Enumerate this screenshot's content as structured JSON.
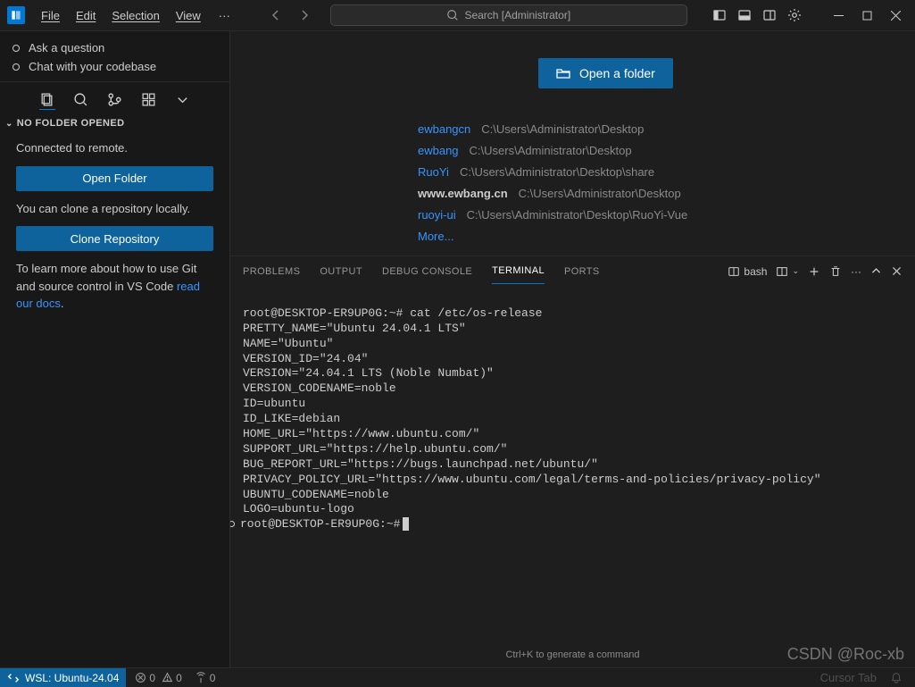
{
  "menu": {
    "file": "File",
    "edit": "Edit",
    "selection": "Selection",
    "view": "View",
    "ellipsis": "···"
  },
  "search": {
    "placeholder": "Search [Administrator]"
  },
  "chat": {
    "ask": "Ask a question",
    "codebase": "Chat with your codebase"
  },
  "explorer": {
    "header": "NO FOLDER OPENED",
    "connected": "Connected to remote.",
    "open_btn": "Open Folder",
    "clone_intro": "You can clone a repository locally.",
    "clone_btn": "Clone Repository",
    "docs_intro": "To learn more about how to use Git and source control in VS Code ",
    "docs_link": "read our docs",
    "docs_period": "."
  },
  "welcome": {
    "open_btn": "Open a folder",
    "recent": [
      {
        "name": "ewbangcn",
        "path": "C:\\Users\\Administrator\\Desktop"
      },
      {
        "name": "ewbang",
        "path": "C:\\Users\\Administrator\\Desktop"
      },
      {
        "name": "RuoYi",
        "path": "C:\\Users\\Administrator\\Desktop\\share"
      },
      {
        "name": "www.ewbang.cn",
        "path": "C:\\Users\\Administrator\\Desktop"
      },
      {
        "name": "ruoyi-ui",
        "path": "C:\\Users\\Administrator\\Desktop\\RuoYi-Vue"
      }
    ],
    "more": "More..."
  },
  "panel": {
    "tabs": {
      "problems": "PROBLEMS",
      "output": "OUTPUT",
      "debug": "DEBUG CONSOLE",
      "terminal": "TERMINAL",
      "ports": "PORTS"
    },
    "shell": "bash",
    "hint": "Ctrl+K to generate a command"
  },
  "terminal": {
    "lines": [
      "root@DESKTOP-ER9UP0G:~# cat /etc/os-release",
      "PRETTY_NAME=\"Ubuntu 24.04.1 LTS\"",
      "NAME=\"Ubuntu\"",
      "VERSION_ID=\"24.04\"",
      "VERSION=\"24.04.1 LTS (Noble Numbat)\"",
      "VERSION_CODENAME=noble",
      "ID=ubuntu",
      "ID_LIKE=debian",
      "HOME_URL=\"https://www.ubuntu.com/\"",
      "SUPPORT_URL=\"https://help.ubuntu.com/\"",
      "BUG_REPORT_URL=\"https://bugs.launchpad.net/ubuntu/\"",
      "PRIVACY_POLICY_URL=\"https://www.ubuntu.com/legal/terms-and-policies/privacy-policy\"",
      "UBUNTU_CODENAME=noble",
      "LOGO=ubuntu-logo"
    ],
    "prompt": "root@DESKTOP-ER9UP0G:~#"
  },
  "status": {
    "remote": "WSL: Ubuntu-24.04",
    "errors": "0",
    "warnings": "0",
    "ports": "0",
    "cursor_tab": "Cursor Tab"
  },
  "watermark": "CSDN @Roc-xb"
}
